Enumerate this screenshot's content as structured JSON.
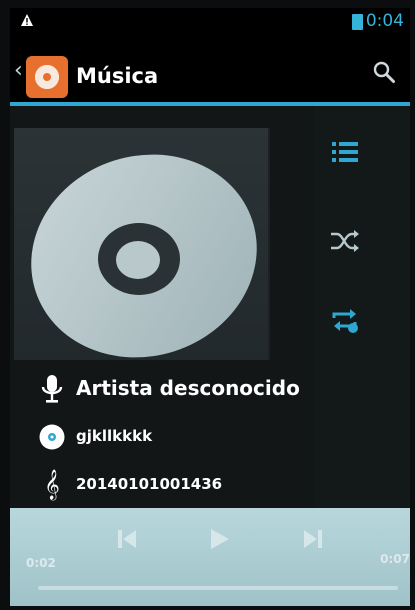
{
  "status_bar": {
    "time": "0:04",
    "warning_icon": "warning-icon",
    "battery_icon": "battery-icon",
    "accent_color": "#36b3d8"
  },
  "action_bar": {
    "title": "Música",
    "app_icon": "music-app-icon",
    "back_icon": "back-chevron-icon",
    "search_icon": "search-icon",
    "underline_color": "#2fa7d0"
  },
  "side_actions": [
    {
      "icon": "queue-list-icon"
    },
    {
      "icon": "shuffle-icon"
    },
    {
      "icon": "repeat-icon"
    }
  ],
  "track": {
    "artist": "Artista desconocido",
    "album": "gjkllkkkk",
    "title": "20140101001436",
    "artist_icon": "microphone-icon",
    "album_icon": "disc-icon",
    "title_icon": "treble-clef-icon"
  },
  "player": {
    "current_time": "0:02",
    "total_time": "0:07",
    "controls": [
      "previous-icon",
      "play-icon",
      "next-icon"
    ]
  }
}
